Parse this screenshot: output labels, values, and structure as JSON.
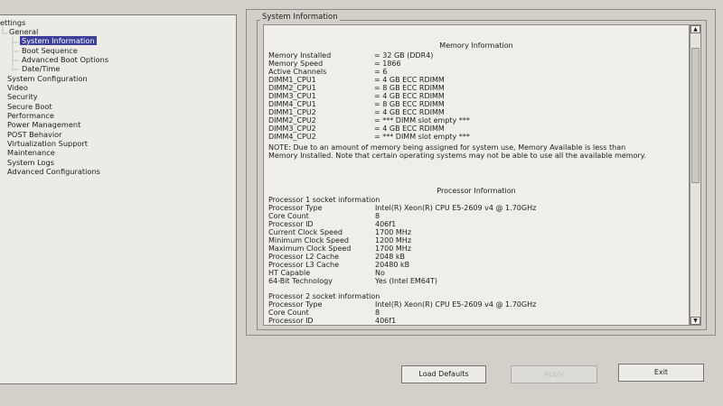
{
  "tree": {
    "root": "ettings",
    "items": [
      {
        "label": "General",
        "level": 1
      },
      {
        "label": "System Information",
        "level": 2,
        "selected": true
      },
      {
        "label": "Boot Sequence",
        "level": 2
      },
      {
        "label": "Advanced Boot Options",
        "level": 2
      },
      {
        "label": "Date/Time",
        "level": 2
      },
      {
        "label": "System Configuration",
        "level": 1
      },
      {
        "label": "Video",
        "level": 1
      },
      {
        "label": "Security",
        "level": 1
      },
      {
        "label": "Secure Boot",
        "level": 1
      },
      {
        "label": "Performance",
        "level": 1
      },
      {
        "label": "Power Management",
        "level": 1
      },
      {
        "label": "POST Behavior",
        "level": 1
      },
      {
        "label": "Virtualization Support",
        "level": 1
      },
      {
        "label": "Maintenance",
        "level": 1
      },
      {
        "label": "System Logs",
        "level": 1
      },
      {
        "label": "Advanced Configurations",
        "level": 1
      }
    ]
  },
  "panel_title": "System Information",
  "memory": {
    "heading": "Memory Information",
    "rows": [
      {
        "label": "Memory Installed",
        "value": "= 32 GB (DDR4)"
      },
      {
        "label": "Memory Speed",
        "value": "= 1866"
      },
      {
        "label": "Active Channels",
        "value": "= 6"
      },
      {
        "label": "DIMM1_CPU1",
        "value": "= 4 GB ECC RDIMM"
      },
      {
        "label": "DIMM2_CPU1",
        "value": "= 8 GB ECC RDIMM"
      },
      {
        "label": "DIMM3_CPU1",
        "value": "= 4 GB ECC RDIMM"
      },
      {
        "label": "DIMM4_CPU1",
        "value": "= 8 GB ECC RDIMM"
      },
      {
        "label": "DIMM1_CPU2",
        "value": "= 4 GB ECC RDIMM"
      },
      {
        "label": "DIMM2_CPU2",
        "value": "= *** DIMM slot empty ***"
      },
      {
        "label": "DIMM3_CPU2",
        "value": "= 4 GB ECC RDIMM"
      },
      {
        "label": "DIMM4_CPU2",
        "value": "= *** DIMM slot empty ***"
      }
    ],
    "note": "NOTE: Due to an amount of memory being assigned for system use, Memory Available is less than Memory Installed. Note that certain operating systems may not be able to use all the available memory."
  },
  "processor": {
    "heading": "Processor Information",
    "socket1_title": "Processor 1 socket information",
    "socket1_rows": [
      {
        "label": "Processor Type",
        "value": "Intel(R) Xeon(R) CPU E5-2609 v4 @ 1.70GHz"
      },
      {
        "label": "Core Count",
        "value": "8"
      },
      {
        "label": "Processor ID",
        "value": "406f1"
      },
      {
        "label": "Current Clock Speed",
        "value": "1700 MHz"
      },
      {
        "label": "Minimum Clock Speed",
        "value": "1200 MHz"
      },
      {
        "label": "Maximum Clock Speed",
        "value": "1700 MHz"
      },
      {
        "label": "Processor L2 Cache",
        "value": "2048 kB"
      },
      {
        "label": "Processor L3 Cache",
        "value": "20480 kB"
      },
      {
        "label": "HT Capable",
        "value": "No"
      },
      {
        "label": "64-Bit Technology",
        "value": "Yes (Intel EM64T)"
      }
    ],
    "socket2_title": "Processor 2 socket information",
    "socket2_rows": [
      {
        "label": "Processor Type",
        "value": "Intel(R) Xeon(R) CPU E5-2609 v4 @ 1.70GHz"
      },
      {
        "label": "Core Count",
        "value": "8"
      },
      {
        "label": "Processor ID",
        "value": "406f1"
      }
    ]
  },
  "scrollbar": {
    "position": 0.1
  },
  "buttons": {
    "load_defaults": "Load Defaults",
    "apply": "Apply",
    "exit": "Exit"
  }
}
